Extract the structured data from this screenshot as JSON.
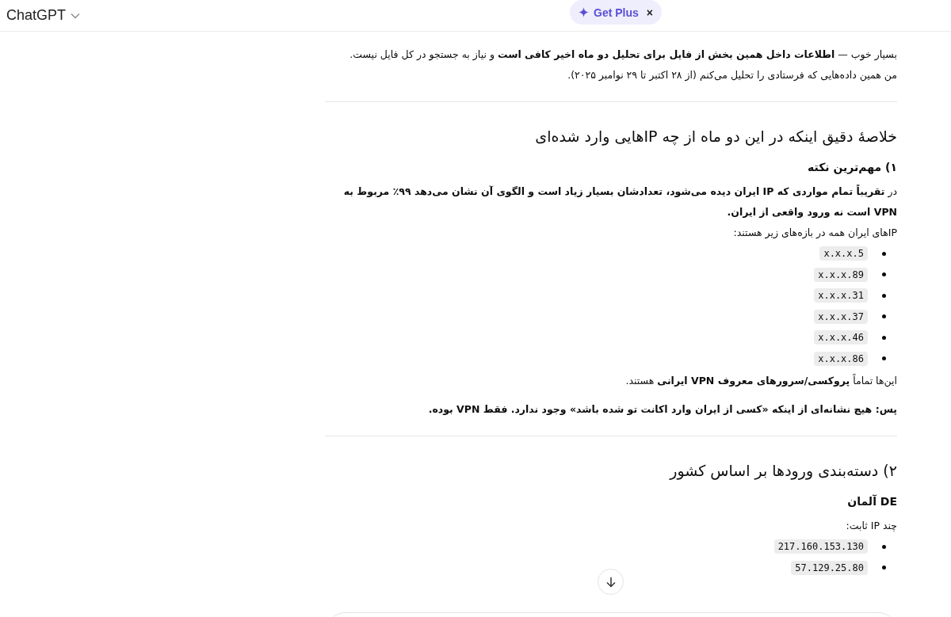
{
  "header": {
    "title": "ChatGPT",
    "upgrade": {
      "label": "Get Plus",
      "close": "×"
    }
  },
  "blocks": [
    {
      "kind": "p",
      "text": "بسیار خوب — **اطلاعات داخل همین بخش از فایل برای تحلیل دو ماه اخیر کافی است** و نیاز به جستجو در کل فایل نیست."
    },
    {
      "kind": "p",
      "text": "من همین داده‌هایی که فرستادی را تحلیل می‌کنم (از ۲۸ اکتبر تا ۲۹ نوامبر ۲۰۲۵)."
    },
    {
      "kind": "hr"
    },
    {
      "kind": "h2",
      "text": "خلاصهٔ دقیق اینکه در این دو ماه از چه IPهایی وارد شده‌ای"
    },
    {
      "kind": "h3",
      "text": "۱) مهم‌ترین نکته"
    },
    {
      "kind": "p",
      "text": "در **تقریباً تمام مواردی که IP ایران دیده می‌شود، تعدادشان بسیار زیاد است و الگوی آن نشان می‌دهد ۹۹٪ مربوط به VPN است نه ورود واقعی از ایران.**"
    },
    {
      "kind": "p",
      "text": "IPهای ایران همه در بازه‌های زیر هستند:"
    },
    {
      "kind": "list",
      "items": [
        "x.x.x.5",
        "x.x.x.89",
        "x.x.x.31",
        "x.x.x.37",
        "x.x.x.46",
        "x.x.x.86"
      ]
    },
    {
      "kind": "p",
      "text": "این‌ها تماماً **پروکسی/سرورهای معروف VPN ایرانی** هستند."
    },
    {
      "kind": "strong",
      "text": "پس: هیچ نشانه‌ای از اینکه «کسی از ایران وارد اکانت تو شده باشد» وجود ندارد. فقط VPN بوده."
    },
    {
      "kind": "hr"
    },
    {
      "kind": "h2",
      "text": "۲) دسته‌بندی ورودها بر اساس کشور"
    },
    {
      "kind": "h3",
      "text": "DE آلمان"
    },
    {
      "kind": "p",
      "text": "چند IP ثابت:"
    },
    {
      "kind": "list",
      "items": [
        "217.160.153.130",
        "57.129.25.80"
      ]
    }
  ]
}
